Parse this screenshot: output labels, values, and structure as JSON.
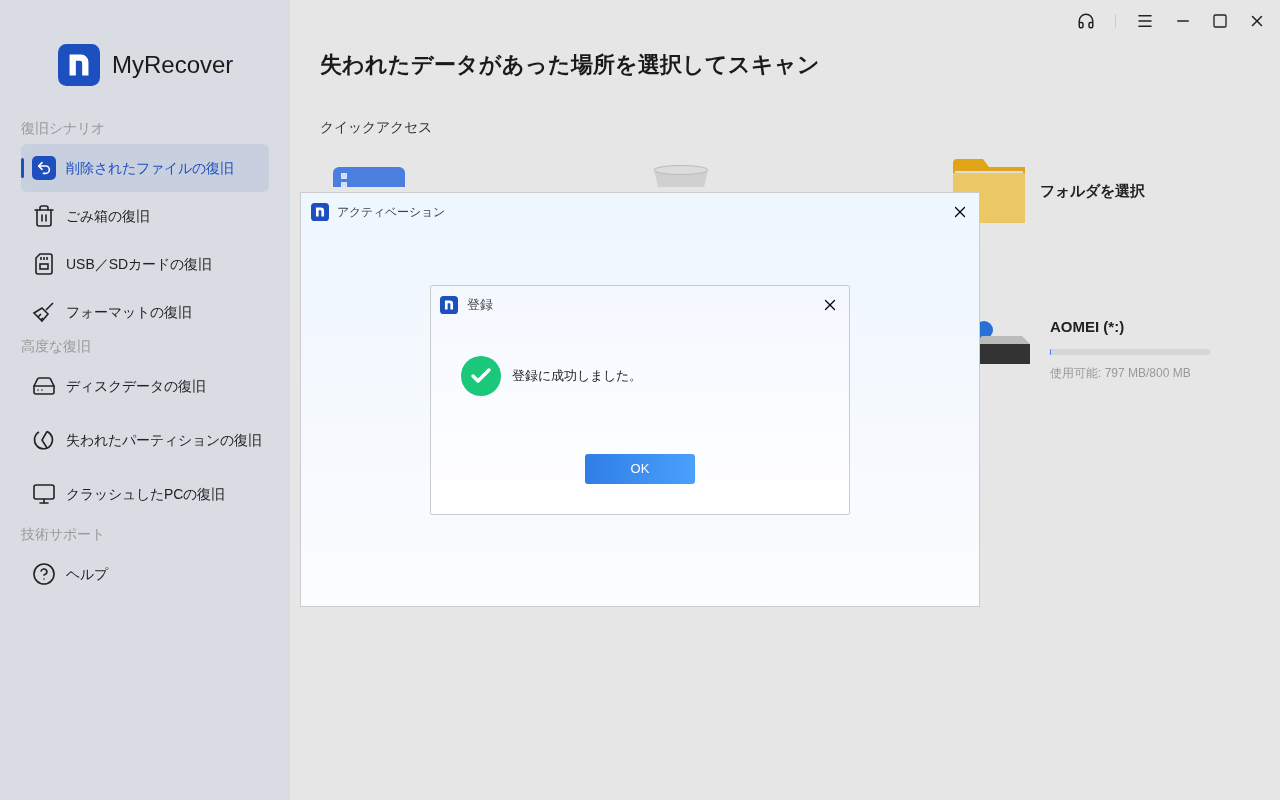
{
  "app": {
    "name": "MyRecover"
  },
  "sidebar": {
    "sections": [
      {
        "title": "復旧シナリオ",
        "items": [
          {
            "kind": "undo",
            "label": "削除されたファイルの復旧",
            "selected": true
          },
          {
            "kind": "trash",
            "label": "ごみ箱の復旧",
            "selected": false
          },
          {
            "kind": "sdcard",
            "label": "USB／SDカードの復旧",
            "selected": false
          },
          {
            "kind": "broom",
            "label": "フォーマットの復旧",
            "selected": false
          }
        ]
      },
      {
        "title": "高度な復旧",
        "items": [
          {
            "kind": "disk",
            "label": "ディスクデータの復旧",
            "selected": false
          },
          {
            "kind": "partition",
            "label": "失われたパーティションの復旧",
            "selected": false
          },
          {
            "kind": "monitor",
            "label": "クラッシュしたPCの復旧",
            "selected": false
          }
        ]
      },
      {
        "title": "技術サポート",
        "items": [
          {
            "kind": "help",
            "label": "ヘルプ",
            "selected": false
          }
        ]
      }
    ]
  },
  "main": {
    "title": "失われたデータがあった場所を選択してスキャン",
    "quick_access": {
      "title": "クイックアクセス",
      "items": [
        {
          "kind": "desktop"
        },
        {
          "kind": "recycle"
        },
        {
          "kind": "folder",
          "label": "フォルダを選択"
        }
      ]
    },
    "drives": [
      {
        "name": "AOMEI (*:)",
        "level": 0.004,
        "available": "使用可能: 797 MB/800 MB"
      }
    ]
  },
  "activation_dialog": {
    "title": "アクティベーション"
  },
  "register_dialog": {
    "title": "登録",
    "message": "登録に成功しました。",
    "button": "OK"
  }
}
